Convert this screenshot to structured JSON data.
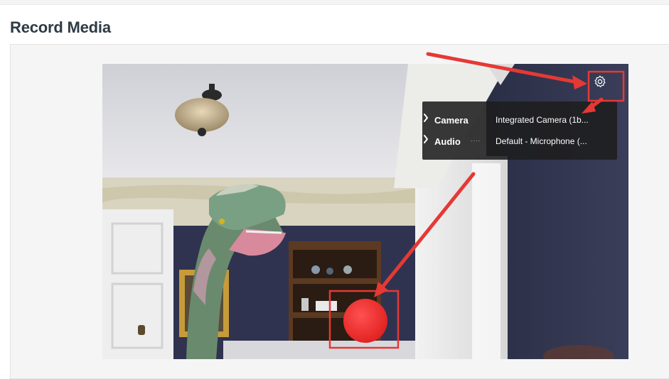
{
  "page": {
    "title": "Record Media"
  },
  "settings_menu": {
    "camera": {
      "label": "Camera",
      "value": "Integrated Camera (1b..."
    },
    "audio": {
      "label": "Audio",
      "dots": "....",
      "value": "Default - Microphone (..."
    }
  },
  "icons": {
    "settings": "gear-icon",
    "menu_arrow": "chevron-right-icon",
    "record": "record-icon"
  },
  "colors": {
    "record": "#e32424",
    "annotation": "#e53935",
    "menu_bg": "#1e1e1e",
    "title": "#2d3b45"
  }
}
